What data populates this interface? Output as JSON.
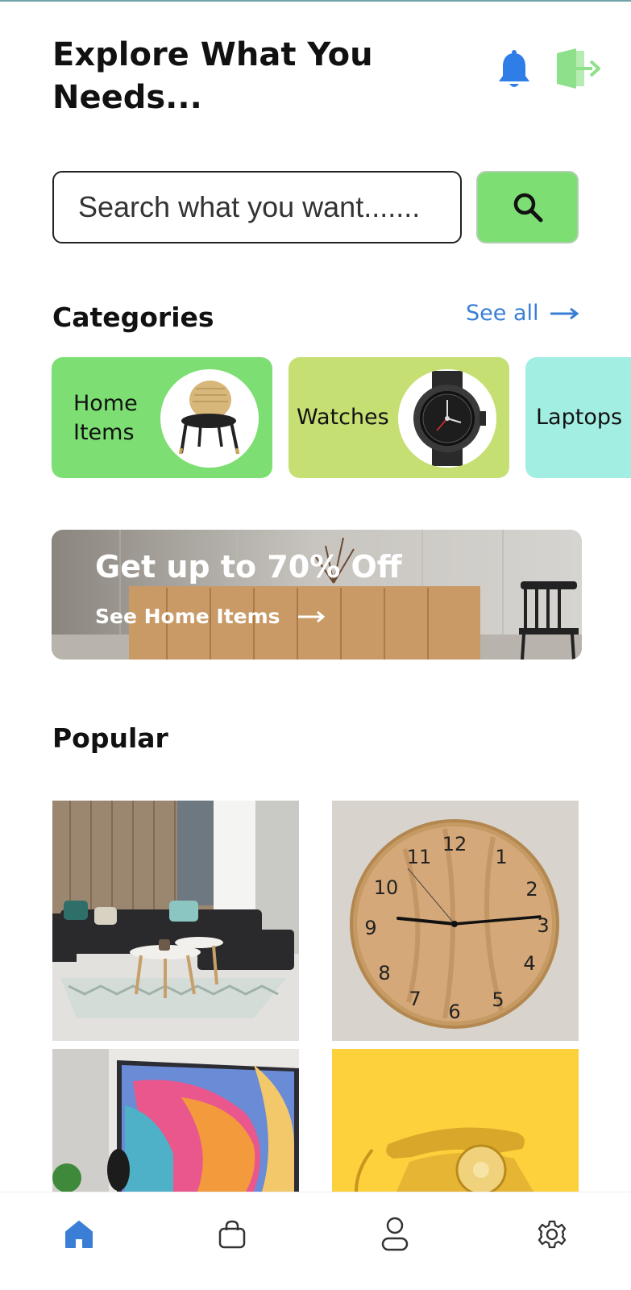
{
  "header": {
    "title": "Explore What You Needs...",
    "bell_icon": "bell-icon",
    "logout_icon": "logout-door-icon"
  },
  "search": {
    "placeholder": "Search what you want.......",
    "button_icon": "search-icon"
  },
  "categories": {
    "title": "Categories",
    "see_all": "See all",
    "items": [
      {
        "label": "Home Items",
        "color": "#7ddf73"
      },
      {
        "label": "Watches",
        "color": "#c5df73"
      },
      {
        "label": "Laptops",
        "color": "#a3eee2"
      }
    ]
  },
  "banner": {
    "title": "Get up to 70% Off",
    "link": "See Home Items"
  },
  "popular": {
    "title": "Popular"
  },
  "nav": {
    "items": [
      "home-icon",
      "shopping-bag-icon",
      "profile-icon",
      "settings-gear-icon"
    ],
    "active_color": "#3a7fd5"
  },
  "colors": {
    "accent_green": "#7ddf73",
    "accent_blue": "#3a7fd5"
  }
}
